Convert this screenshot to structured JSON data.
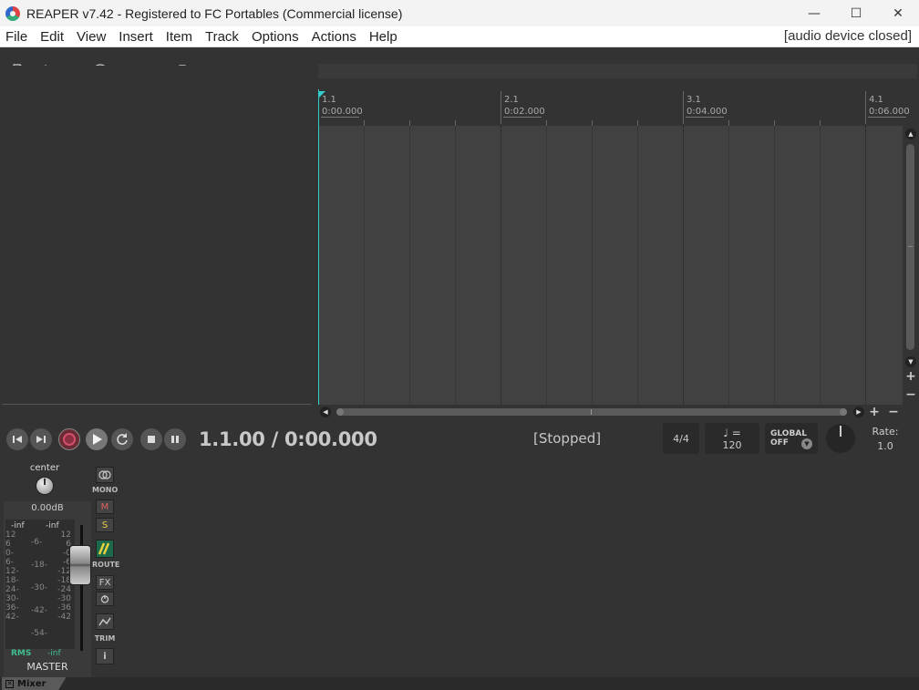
{
  "window": {
    "title": "REAPER v7.42 - Registered to FC Portables (Commercial license)",
    "minimize": "—",
    "maximize": "☐",
    "close": "✕"
  },
  "menu": {
    "items": [
      "File",
      "Edit",
      "View",
      "Insert",
      "Item",
      "Track",
      "Options",
      "Actions",
      "Help"
    ],
    "status": "[audio device closed]"
  },
  "toolbar": {
    "row1": [
      "new-project-icon",
      "open-project-icon",
      "save-project-icon",
      "project-settings-icon",
      "undo-icon",
      "redo-icon",
      "metronome-icon"
    ],
    "row2": [
      "ripple-edit-icon",
      "item-grouping-icon",
      "grid-icon",
      "snap-icon",
      "auto-crossfade-icon",
      "envelope-points-icon",
      "lock-icon"
    ]
  },
  "ruler": {
    "marks": [
      {
        "bar": "1.1",
        "time": "0:00.000"
      },
      {
        "bar": "2.1",
        "time": "0:02.000"
      },
      {
        "bar": "3.1",
        "time": "0:04.000"
      },
      {
        "bar": "4.1",
        "time": "0:06.000"
      }
    ]
  },
  "transport": {
    "position": "1.1.00 / 0:00.000",
    "state": "[Stopped]",
    "time_signature": "4/4",
    "tempo_symbol": "♩ =",
    "tempo": "120",
    "global_label": "GLOBAL",
    "global_value": "OFF",
    "rate_label": "Rate:",
    "rate_value": "1.0"
  },
  "master": {
    "pan_label": "center",
    "volume": "0.00dB",
    "peak_left": "-inf",
    "peak_right": "-inf",
    "scale_left": [
      "12",
      "6",
      "0-",
      "6-",
      "12-",
      "18-",
      "24-",
      "30-",
      "36-",
      "42-"
    ],
    "scale_right": [
      "12",
      "6",
      "-0",
      "-6",
      "-12",
      "-18",
      "-24",
      "-30",
      "-36",
      "-42"
    ],
    "scale_mid": [
      "-6-",
      "-18-",
      "-30-",
      "-42-",
      "-54-"
    ],
    "rms_label": "RMS",
    "rms_value": "-inf",
    "name": "MASTER",
    "mono_label": "MONO",
    "mute": "M",
    "solo": "S",
    "route_label": "ROUTE",
    "fx": "FX",
    "trim_label": "TRIM",
    "info": "i"
  },
  "dock": {
    "tab_label": "Mixer",
    "close_glyph": "✕"
  }
}
